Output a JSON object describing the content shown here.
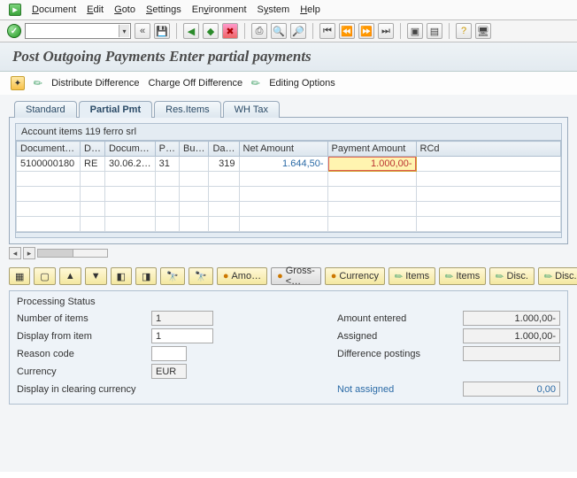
{
  "menubar": {
    "document": "Document",
    "edit": "Edit",
    "goto": "Goto",
    "settings": "Settings",
    "environment": "Environment",
    "system": "System",
    "help": "Help"
  },
  "title": "Post Outgoing Payments Enter partial payments",
  "subtoolbar": {
    "distribute": "Distribute Difference",
    "charge_off": "Charge Off Difference",
    "editing": "Editing Options"
  },
  "tabs": {
    "standard": "Standard",
    "partial": "Partial Pmt",
    "res": "Res.Items",
    "wh": "WH Tax"
  },
  "grid": {
    "title": "Account items 119 ferro srl",
    "headers": {
      "doc": "Document…",
      "d": "D…",
      "docdate": "Docum…",
      "p": "P…",
      "bu": "Bu…",
      "da": "Da…",
      "net": "Net Amount",
      "pay": "Payment Amount",
      "rcd": "RCd"
    },
    "rows": [
      {
        "doc": "5100000180",
        "d": "RE",
        "docdate": "30.06.2…",
        "p": "31",
        "bu": "",
        "da": "319",
        "net": "1.644,50-",
        "pay": "1.000,00-",
        "rcd": ""
      }
    ]
  },
  "actions": {
    "amo": "Amo…",
    "gross": "Gross-<…",
    "currency": "Currency",
    "items1": "Items",
    "items2": "Items",
    "disc1": "Disc.",
    "disc2": "Disc."
  },
  "status": {
    "panel_title": "Processing Status",
    "num_items_label": "Number of items",
    "num_items": "1",
    "display_from_label": "Display from item",
    "display_from": "1",
    "reason_code_label": "Reason code",
    "reason_code": "",
    "currency_label": "Currency",
    "currency": "EUR",
    "display_clearing_label": "Display in clearing currency",
    "amount_entered_label": "Amount entered",
    "amount_entered": "1.000,00-",
    "assigned_label": "Assigned",
    "assigned": "1.000,00-",
    "diff_label": "Difference postings",
    "diff": "",
    "not_assigned_label": "Not assigned",
    "not_assigned": "0,00"
  }
}
